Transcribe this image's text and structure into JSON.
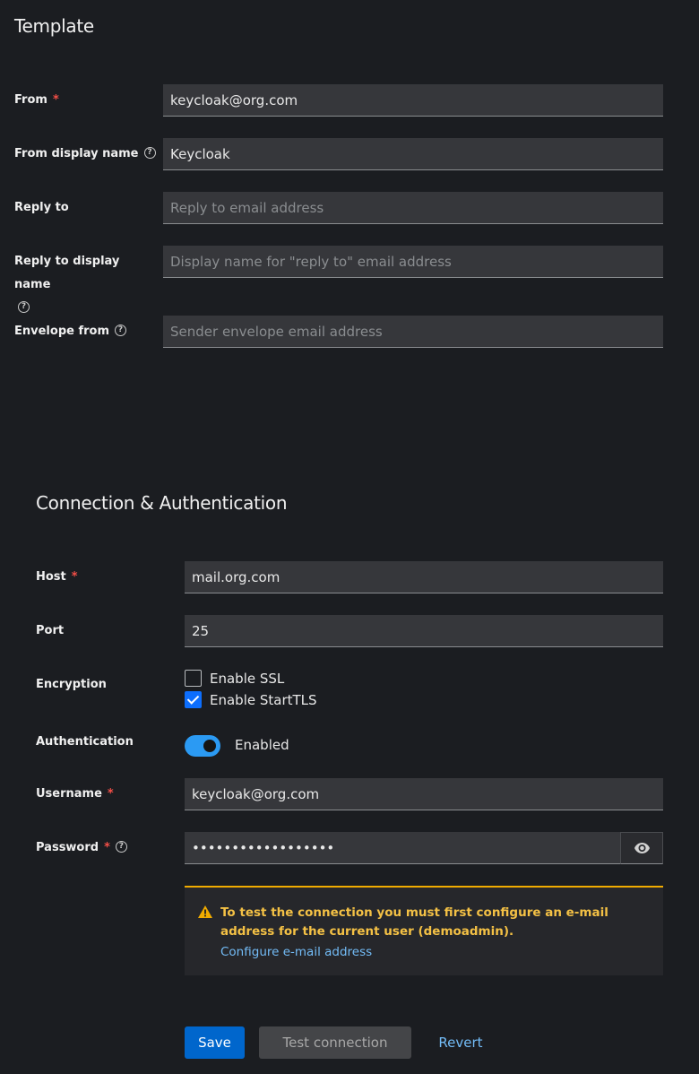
{
  "template": {
    "title": "Template",
    "from": {
      "label": "From",
      "required": "*",
      "value": "keycloak@org.com"
    },
    "from_display_name": {
      "label": "From display name",
      "value": "Keycloak"
    },
    "reply_to": {
      "label": "Reply to",
      "placeholder": "Reply to email address"
    },
    "reply_to_display_name": {
      "label": "Reply to display name",
      "placeholder": "Display name for \"reply to\" email address"
    },
    "envelope_from": {
      "label": "Envelope from",
      "placeholder": "Sender envelope email address"
    }
  },
  "connection": {
    "title": "Connection & Authentication",
    "host": {
      "label": "Host",
      "required": "*",
      "value": "mail.org.com"
    },
    "port": {
      "label": "Port",
      "value": "25"
    },
    "encryption": {
      "label": "Encryption",
      "ssl": {
        "label": "Enable SSL",
        "checked": false
      },
      "starttls": {
        "label": "Enable StartTLS",
        "checked": true
      }
    },
    "authentication": {
      "label": "Authentication",
      "toggle_label": "Enabled",
      "enabled": true
    },
    "username": {
      "label": "Username",
      "required": "*",
      "value": "keycloak@org.com"
    },
    "password": {
      "label": "Password",
      "required": "*",
      "value": "••••••••••••••••••"
    },
    "alert": {
      "message": "To test the connection you must first configure an e-mail address for the current user (demoadmin).",
      "link": "Configure e-mail address"
    }
  },
  "actions": {
    "save": "Save",
    "test_connection": "Test connection",
    "revert": "Revert"
  },
  "icons": {
    "help": "help-circle-icon",
    "warning": "warning-triangle-icon",
    "eye": "eye-icon"
  },
  "colors": {
    "background": "#1b1d21",
    "field": "#36373b",
    "required": "#f54f47",
    "primary": "#0066cc",
    "link": "#73bcf7",
    "warning": "#f0ab00"
  }
}
